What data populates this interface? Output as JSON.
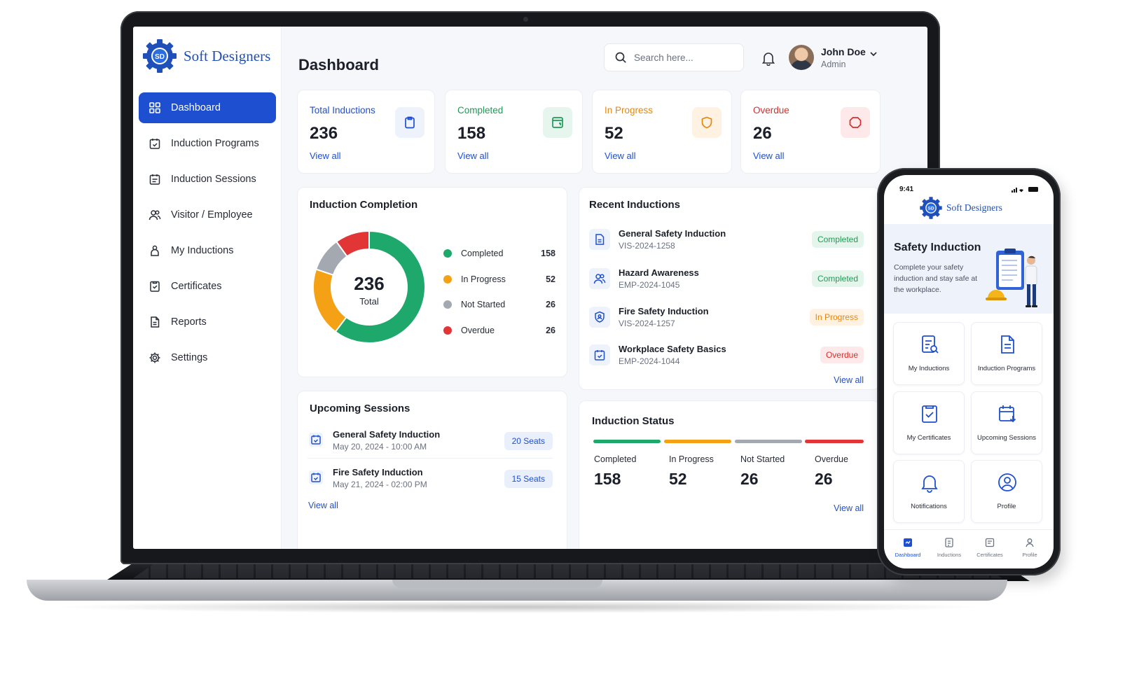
{
  "brand": {
    "name": "Soft Designers",
    "logo_text": "SD"
  },
  "sidebar": {
    "items": [
      {
        "label": "Dashboard",
        "icon": "grid-icon",
        "active": true
      },
      {
        "label": "Induction Programs",
        "icon": "calendar-check-icon"
      },
      {
        "label": "Induction Sessions",
        "icon": "calendar-list-icon"
      },
      {
        "label": "Visitor / Employee",
        "icon": "users-icon"
      },
      {
        "label": "My Inductions",
        "icon": "hand-icon"
      },
      {
        "label": "Certificates",
        "icon": "certificate-icon"
      },
      {
        "label": "Reports",
        "icon": "document-icon"
      },
      {
        "label": "Settings",
        "icon": "gear-icon"
      }
    ]
  },
  "header": {
    "title": "Dashboard",
    "search_placeholder": "Search here...",
    "user": {
      "name": "John Doe",
      "role": "Admin"
    }
  },
  "stats": [
    {
      "label": "Total Inductions",
      "value": "236",
      "link": "View all",
      "color": "#1f4fd1",
      "bg": "#eef2fb",
      "icon": "clipboard-icon"
    },
    {
      "label": "Completed",
      "value": "158",
      "link": "View all",
      "color": "#1f9a55",
      "bg": "#e6f6ee",
      "icon": "calendar-icon"
    },
    {
      "label": "In Progress",
      "value": "52",
      "link": "View all",
      "color": "#e8860b",
      "bg": "#fff2e2",
      "icon": "shield-icon"
    },
    {
      "label": "Overdue",
      "value": "26",
      "link": "View all",
      "color": "#d92d2d",
      "bg": "#fde9e9",
      "icon": "alert-icon"
    }
  ],
  "completion": {
    "title": "Induction Completion",
    "total": "236",
    "total_label": "Total",
    "legend": [
      {
        "label": "Completed",
        "value": "158",
        "color": "#1ea86b"
      },
      {
        "label": "In Progress",
        "value": "52",
        "color": "#f5a116"
      },
      {
        "label": "Not Started",
        "value": "26",
        "color": "#a4a8b1"
      },
      {
        "label": "Overdue",
        "value": "26",
        "color": "#e23636"
      }
    ]
  },
  "chart_data": {
    "type": "pie",
    "title": "Induction Completion",
    "categories": [
      "Completed",
      "In Progress",
      "Not Started",
      "Overdue"
    ],
    "values": [
      158,
      52,
      26,
      26
    ],
    "colors": [
      "#1ea86b",
      "#f5a116",
      "#a4a8b1",
      "#e23636"
    ],
    "donut": true,
    "center_label": "236 Total",
    "legend": "right"
  },
  "recent": {
    "title": "Recent Inductions",
    "items": [
      {
        "title": "General Safety Induction",
        "code": "VIS-2024-1258",
        "status": "Completed",
        "tone": "green",
        "icon": "document-icon"
      },
      {
        "title": "Hazard Awareness",
        "code": "EMP-2024-1045",
        "status": "Completed",
        "tone": "green",
        "icon": "users-icon"
      },
      {
        "title": "Fire Safety Induction",
        "code": "VIS-2024-1257",
        "status": "In Progress",
        "tone": "orange",
        "icon": "shield-user-icon"
      },
      {
        "title": "Workplace Safety Basics",
        "code": "EMP-2024-1044",
        "status": "Overdue",
        "tone": "red",
        "icon": "calendar-check-icon"
      }
    ],
    "link": "View all"
  },
  "upcoming": {
    "title": "Upcoming Sessions",
    "items": [
      {
        "title": "General Safety Induction",
        "time": "May 20, 2024 - 10:00 AM",
        "seats": "20 Seats"
      },
      {
        "title": "Fire Safety Induction",
        "time": "May 21, 2024 - 02:00 PM",
        "seats": "15 Seats"
      }
    ],
    "link": "View all"
  },
  "status": {
    "title": "Induction Status",
    "items": [
      {
        "label": "Completed",
        "value": "158",
        "color": "#1ea86b"
      },
      {
        "label": "In Progress",
        "value": "52",
        "color": "#f5a116"
      },
      {
        "label": "Not Started",
        "value": "26",
        "color": "#a4a8b1"
      },
      {
        "label": "Overdue",
        "value": "26",
        "color": "#e23636"
      }
    ],
    "link": "View all"
  },
  "phone": {
    "time": "9:41",
    "brand": "Soft Designers",
    "hero_title": "Safety Induction",
    "hero_desc": "Complete your safety induction and stay safe at the workplace.",
    "tiles": [
      {
        "label": "My Inductions",
        "icon": "clipboard-search-icon"
      },
      {
        "label": "Induction Programs",
        "icon": "document-icon"
      },
      {
        "label": "My Certificates",
        "icon": "certificate-icon"
      },
      {
        "label": "Upcoming Sessions",
        "icon": "calendar-arrow-icon"
      },
      {
        "label": "Notifications",
        "icon": "bell-icon"
      },
      {
        "label": "Profile",
        "icon": "user-circle-icon"
      }
    ],
    "tabs": [
      {
        "label": "Dashboard",
        "icon": "dashboard-icon",
        "active": true
      },
      {
        "label": "Inductions",
        "icon": "list-icon"
      },
      {
        "label": "Certificates",
        "icon": "certificate-icon"
      },
      {
        "label": "Profile",
        "icon": "user-icon"
      }
    ]
  }
}
